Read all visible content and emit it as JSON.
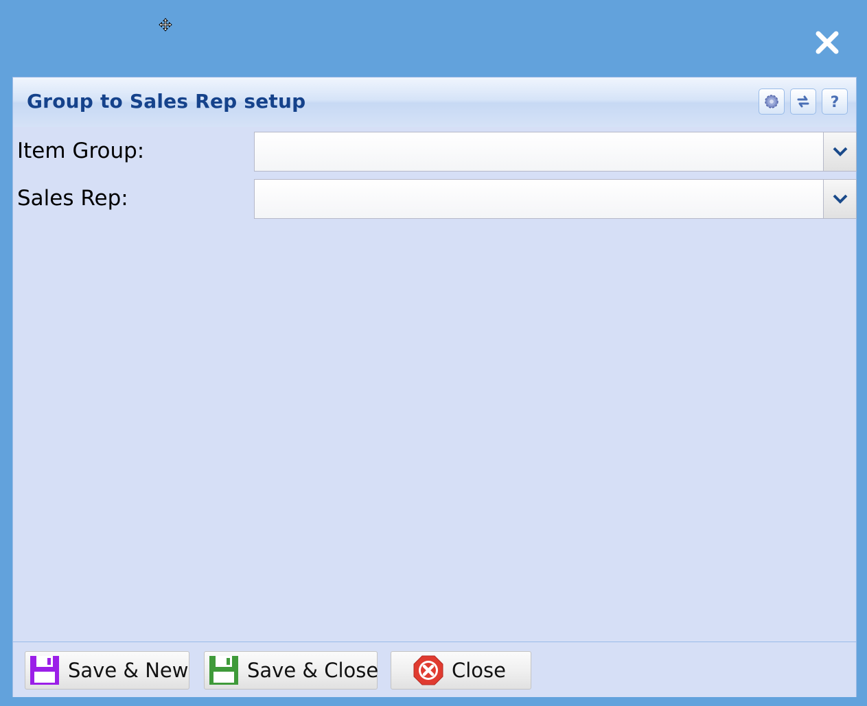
{
  "window": {
    "move_icon": "move-cursor-icon",
    "close_icon": "close-icon"
  },
  "panel": {
    "title": "Group to Sales Rep setup",
    "tools": [
      {
        "icon": "gear-icon"
      },
      {
        "icon": "refresh-icon"
      },
      {
        "icon": "help-icon"
      }
    ]
  },
  "form": {
    "item_group": {
      "label": "Item Group:",
      "value": "",
      "placeholder": ""
    },
    "sales_rep": {
      "label": "Sales Rep:",
      "value": "",
      "placeholder": ""
    }
  },
  "footer": {
    "save_new": {
      "label": "Save & New",
      "icon": "floppy-disk-icon",
      "icon_color": "#9b1fe8"
    },
    "save_close": {
      "label": "Save & Close",
      "icon": "floppy-disk-icon",
      "icon_color": "#3f9a3a"
    },
    "close": {
      "label": "Close",
      "icon": "close-circle-icon",
      "icon_color": "#e03b30"
    }
  },
  "colors": {
    "background": "#62a2dc",
    "panel": "#d6dff6",
    "title": "#15428b"
  }
}
